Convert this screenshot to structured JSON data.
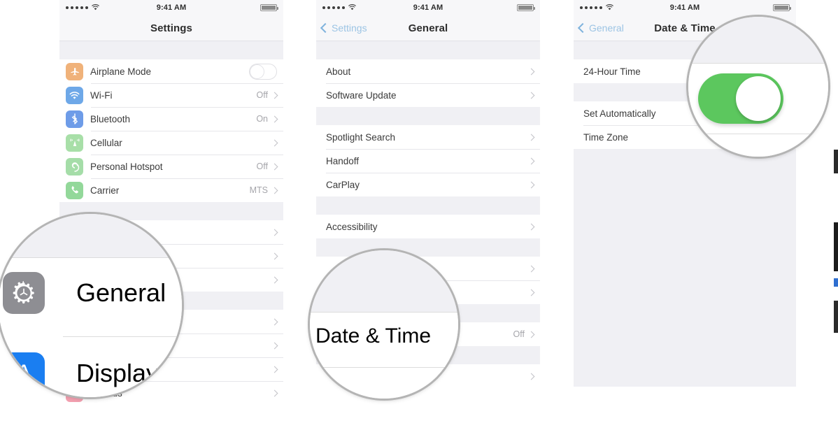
{
  "statusbar": {
    "time": "9:41 AM",
    "signal_dots": 5,
    "battery_full": true
  },
  "panels": [
    {
      "id": "settings",
      "nav": {
        "back": null,
        "title": "Settings"
      },
      "groups": [
        {
          "rows": [
            {
              "label": "Airplane Mode",
              "icon": "airplane-icon",
              "glyph": "✈",
              "color": "#f0b27a",
              "control": "toggle-off"
            },
            {
              "label": "Wi-Fi",
              "icon": "wifi-icon",
              "glyph": "◔",
              "color": "#6ea8e8",
              "value": "Off",
              "chevron": true
            },
            {
              "label": "Bluetooth",
              "icon": "bluetooth-icon",
              "glyph": "ᛦ",
              "color": "#6e9ce8",
              "value": "On",
              "chevron": true
            },
            {
              "label": "Cellular",
              "icon": "cellular-icon",
              "glyph": "()",
              "color": "#a8dfa8",
              "value": "",
              "chevron": true
            },
            {
              "label": "Personal Hotspot",
              "icon": "hotspot-icon",
              "glyph": "⚭",
              "color": "#a5dda8",
              "value": "Off",
              "chevron": true
            },
            {
              "label": "Carrier",
              "icon": "carrier-icon",
              "glyph": "✆",
              "color": "#93d89a",
              "value": "MTS",
              "chevron": true
            }
          ]
        },
        {
          "rows": [
            {
              "label": "",
              "chevron": true
            },
            {
              "label": "",
              "chevron": true
            },
            {
              "label": "",
              "chevron": true
            }
          ]
        },
        {
          "rows": [
            {
              "label": "",
              "chevron": true
            },
            {
              "label": "",
              "chevron": true
            },
            {
              "label": "",
              "chevron": true
            },
            {
              "label": "",
              "chevron": true
            }
          ]
        },
        {
          "rows": [
            {
              "label": "Sounds",
              "icon": "sounds-icon",
              "glyph": "◂",
              "color": "#f3a0b0"
            }
          ]
        }
      ]
    },
    {
      "id": "general",
      "nav": {
        "back": "Settings",
        "title": "General"
      },
      "groups": [
        {
          "rows": [
            {
              "label": "About",
              "chevron": true
            },
            {
              "label": "Software Update",
              "chevron": true
            }
          ]
        },
        {
          "rows": [
            {
              "label": "Spotlight Search",
              "chevron": true
            },
            {
              "label": "Handoff",
              "chevron": true
            },
            {
              "label": "CarPlay",
              "chevron": true
            }
          ]
        },
        {
          "rows": [
            {
              "label": "Accessibility",
              "chevron": true
            }
          ]
        },
        {
          "rows": [
            {
              "label": "",
              "chevron": true
            },
            {
              "label": "",
              "chevron": true
            }
          ]
        },
        {
          "rows": [
            {
              "label": "",
              "value": "Off",
              "chevron": true
            }
          ]
        },
        {
          "rows": [
            {
              "label": "",
              "chevron": true
            }
          ]
        }
      ]
    },
    {
      "id": "datetime",
      "nav": {
        "back": "General",
        "title": "Date & Time"
      },
      "groups": [
        {
          "rows": [
            {
              "label": "24-Hour Time",
              "control": "toggle-hidden"
            }
          ]
        },
        {
          "rows": [
            {
              "label": "Set Automatically",
              "control": "toggle-hidden"
            },
            {
              "label": "Time Zone"
            }
          ]
        }
      ]
    }
  ],
  "magnifiers": [
    {
      "id": "magnifier-general",
      "target_panel": "settings",
      "items": [
        {
          "label": "General",
          "icon": "gear-icon",
          "color": "#8e8e93"
        },
        {
          "label": "Display",
          "icon": "display-icon",
          "color": "#1a7ef1",
          "glyph": "A"
        }
      ]
    },
    {
      "id": "magnifier-date-time",
      "target_panel": "general",
      "items": [
        {
          "label": "Date & Time"
        }
      ]
    },
    {
      "id": "magnifier-set-automatically-toggle",
      "target_panel": "datetime",
      "control": {
        "type": "toggle",
        "state": "on",
        "color": "#5cc75e"
      }
    }
  ],
  "colors": {
    "toggle_on_green": "#5cc75e",
    "nav_tint_blue": "#9cc4e4",
    "group_band": "#f0f0f4",
    "separator": "#e6e6ea",
    "text_primary": "#3a3a3a",
    "text_secondary": "#a6a6ab"
  }
}
